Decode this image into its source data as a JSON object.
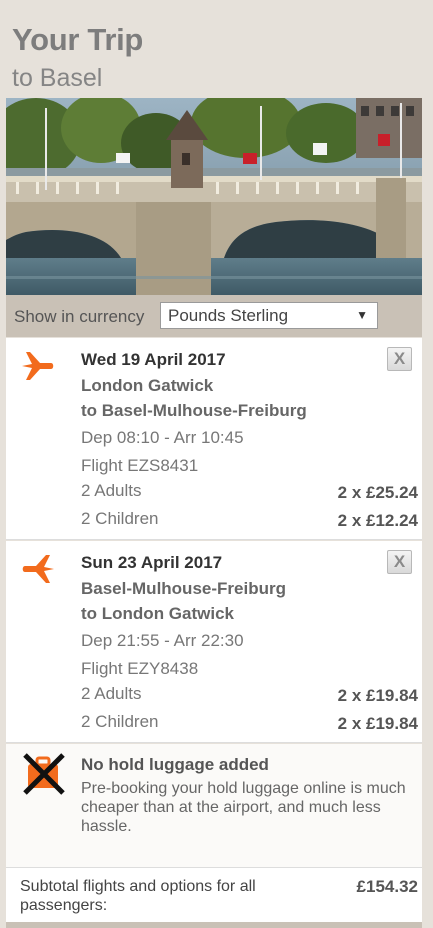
{
  "trip": {
    "title": "Your Trip",
    "subtitle": "to Basel"
  },
  "currency": {
    "label": "Show in currency",
    "selected": "Pounds Sterling"
  },
  "flights": [
    {
      "date": "Wed 19 April 2017",
      "from": "London Gatwick",
      "to": "to Basel-Mulhouse-Freiburg",
      "times": "Dep 08:10 - Arr 10:45",
      "flight": "Flight EZS8431",
      "pax": [
        {
          "label": "2 Adults",
          "price": "2 x £25.24"
        },
        {
          "label": "2 Children",
          "price": "2 x £12.24"
        }
      ],
      "remove_label": "X"
    },
    {
      "date": "Sun 23 April 2017",
      "from": "Basel-Mulhouse-Freiburg",
      "to": "to London Gatwick",
      "times": "Dep 21:55 - Arr 22:30",
      "flight": "Flight EZY8438",
      "pax": [
        {
          "label": "2 Adults",
          "price": "2 x £19.84"
        },
        {
          "label": "2 Children",
          "price": "2 x £19.84"
        }
      ],
      "remove_label": "X"
    }
  ],
  "luggage": {
    "title": "No hold luggage added",
    "text": "Pre-booking your hold luggage online is much cheaper than at the airport, and much less hassle."
  },
  "subtotal": {
    "label": "Subtotal flights and options for all passengers:",
    "value": "£154.32"
  },
  "colors": {
    "accent": "#f26b1d",
    "panel": "#e6e1da",
    "bar": "#c9c1b6"
  },
  "icons": {
    "plane": "plane-icon",
    "luggage": "no-luggage-icon",
    "close": "close-icon",
    "dropdown": "chevron-down-icon"
  }
}
